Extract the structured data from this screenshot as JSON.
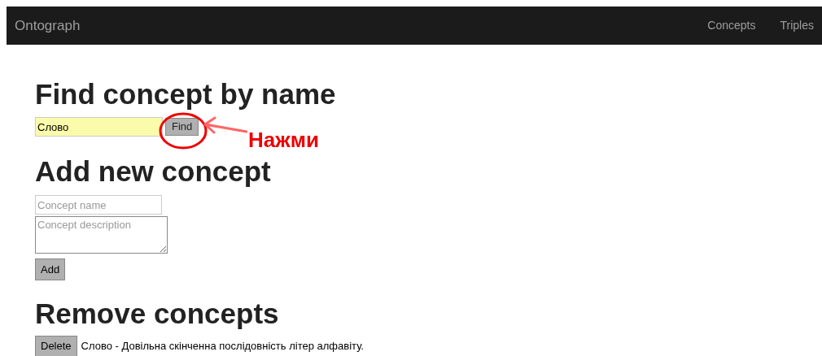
{
  "navbar": {
    "brand": "Ontograph",
    "links": [
      "Concepts",
      "Triples"
    ]
  },
  "find": {
    "heading": "Find concept by name",
    "value": "Слово",
    "button": "Find"
  },
  "annotation": {
    "text": "Нажми"
  },
  "add": {
    "heading": "Add new concept",
    "name_placeholder": "Concept name",
    "description_placeholder": "Concept description",
    "button": "Add"
  },
  "remove": {
    "heading": "Remove concepts",
    "items": [
      {
        "button": "Delete",
        "text": "Слово - Довільна скінченна послідовність літер алфавіту."
      }
    ]
  }
}
